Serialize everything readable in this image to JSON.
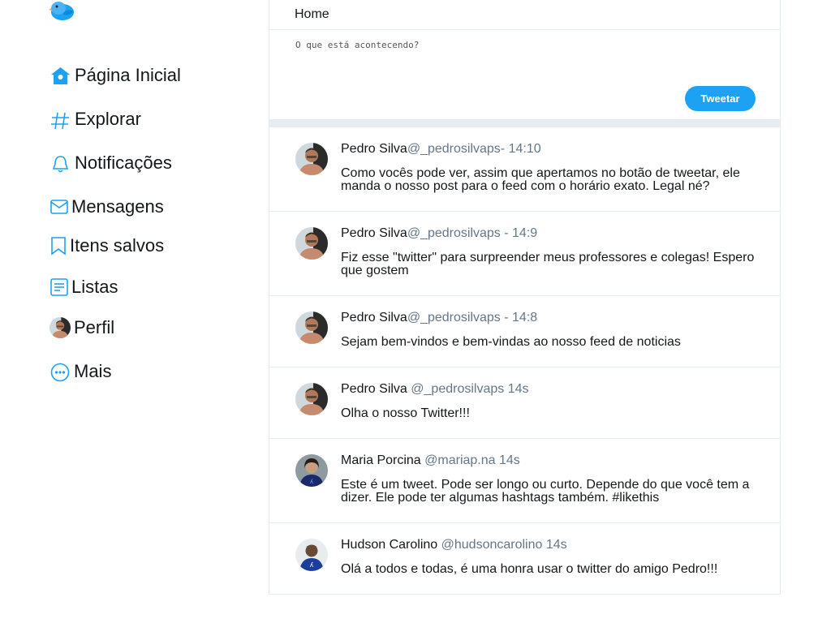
{
  "nav": [
    {
      "label": "Página Inicial",
      "icon": "home-icon"
    },
    {
      "label": "Explorar",
      "icon": "hashtag-icon"
    },
    {
      "label": "Notificações",
      "icon": "bell-icon"
    },
    {
      "label": "Mensagens",
      "icon": "envelope-icon"
    },
    {
      "label": "Itens salvos",
      "icon": "bookmark-icon"
    },
    {
      "label": "Listas",
      "icon": "list-icon"
    },
    {
      "label": "Perfil",
      "icon": "avatar"
    },
    {
      "label": "Mais",
      "icon": "more-icon"
    }
  ],
  "header": {
    "title": "Home"
  },
  "composer": {
    "placeholder": "O que está acontecendo?",
    "button_label": "Tweetar"
  },
  "tweets": [
    {
      "name": "Pedro Silva",
      "handle": "@_pedrosilvaps",
      "time": "- 14:10",
      "text": "Como vocês pode ver, assim que apertamos no botão de tweetar, ele manda o nosso post para o feed com o horário exato. Legal né?"
    },
    {
      "name": "Pedro Silva",
      "handle": "@_pedrosilvaps",
      "time": " - 14:9",
      "text": "Fiz esse \"twitter\" para surpreender meus professores e colegas! Espero que gostem"
    },
    {
      "name": "Pedro Silva",
      "handle": "@_pedrosilvaps",
      "time": " - 14:8",
      "text": "Sejam bem-vindos e bem-vindas ao nosso feed de noticias"
    },
    {
      "name": "Pedro Silva",
      "handle": " @_pedrosilvaps",
      "time": " 14s",
      "text": "Olha o nosso Twitter!!!"
    },
    {
      "name": "Maria Porcina",
      "handle": " @mariap.na",
      "time": " 14s",
      "text": "Este é um tweet. Pode ser longo ou curto. Depende do que você tem a dizer. Ele pode ter algumas hashtags também. #likethis"
    },
    {
      "name": "Hudson Carolino",
      "handle": " @hudsoncarolino",
      "time": " 14s",
      "text": "Olá a todos e todas, é uma honra usar o twitter do amigo Pedro!!!"
    }
  ],
  "colors": {
    "accent": "#1da1f2",
    "border": "#e6ecf0",
    "muted": "#657786"
  }
}
